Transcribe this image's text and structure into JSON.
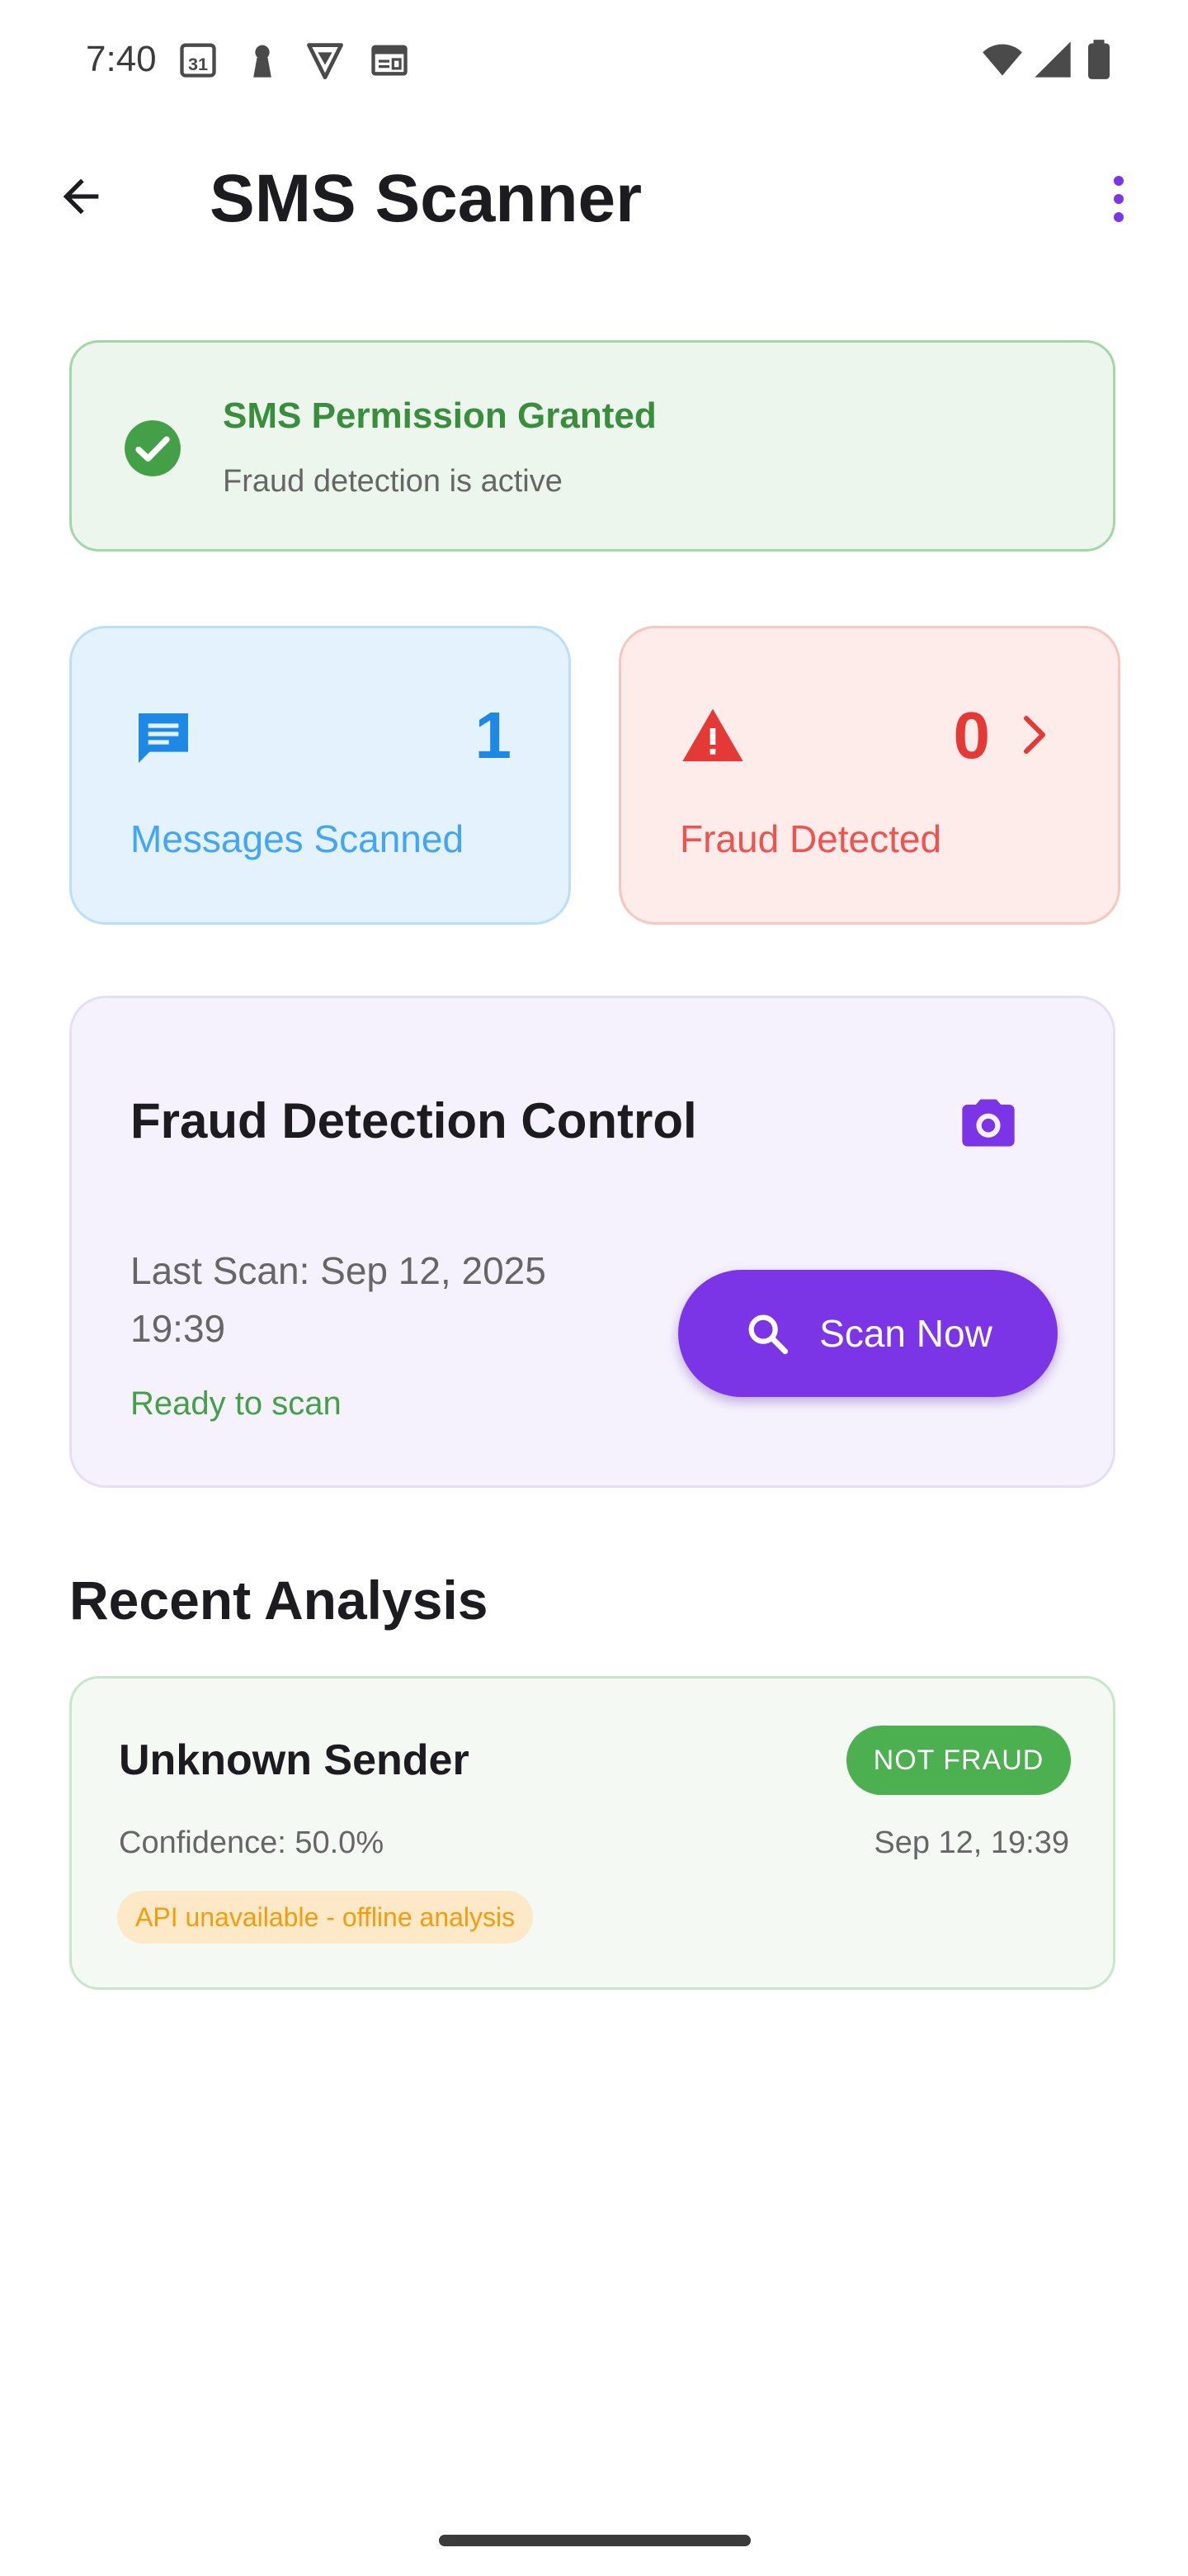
{
  "status_bar": {
    "time": "7:40",
    "left_icons": [
      "calendar-icon",
      "keyhole-icon",
      "shield-icon",
      "news-icon"
    ],
    "right_icons": [
      "wifi-icon",
      "signal-icon",
      "battery-icon"
    ]
  },
  "app_bar": {
    "title": "SMS Scanner",
    "back_icon": "arrow-back-icon",
    "menu_icon": "more-vert-icon"
  },
  "permission": {
    "title": "SMS Permission Granted",
    "subtitle": "Fraud detection is active",
    "icon": "check-circle-icon"
  },
  "stats": {
    "scanned": {
      "value": "1",
      "label": "Messages Scanned",
      "icon": "message-icon"
    },
    "fraud": {
      "value": "0",
      "label": "Fraud Detected",
      "icon": "warning-icon"
    }
  },
  "control": {
    "title": "Fraud Detection Control",
    "last_scan": "Last Scan: Sep 12, 2025 19:39",
    "status": "Ready to scan",
    "scan_button": "Scan Now"
  },
  "recent": {
    "title": "Recent Analysis",
    "items": [
      {
        "sender": "Unknown Sender",
        "badge": "NOT FRAUD",
        "confidence": "Confidence: 50.0%",
        "time": "Sep 12, 19:39",
        "note": "API unavailable - offline analysis"
      }
    ]
  },
  "colors": {
    "accent": "#7b35e6",
    "success": "#43a047",
    "info": "#1e88e5",
    "danger": "#e53935",
    "warning": "#f59c0b"
  }
}
